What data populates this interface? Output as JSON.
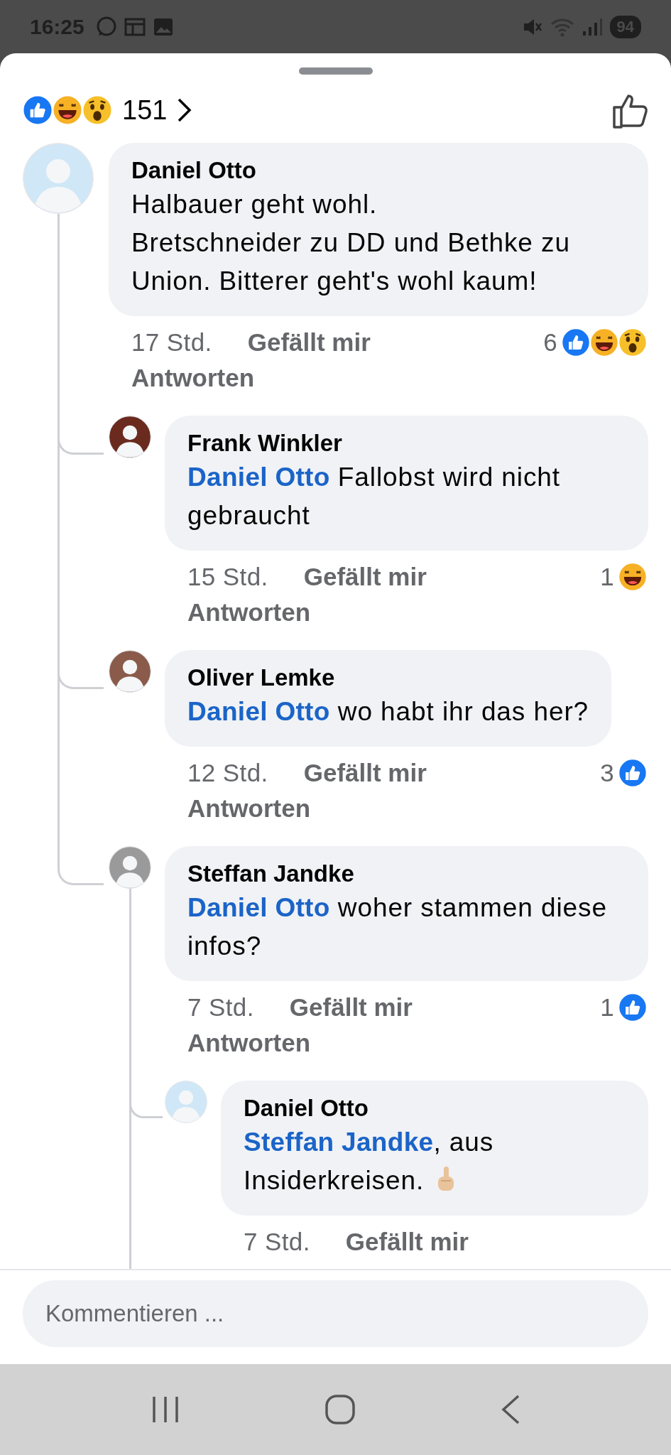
{
  "status_bar": {
    "time": "16:25",
    "battery": "94"
  },
  "header": {
    "reactions": [
      {
        "kind": "like"
      },
      {
        "kind": "haha"
      },
      {
        "kind": "wow"
      }
    ],
    "count": "151"
  },
  "comments": [
    {
      "author": "Daniel Otto",
      "text": "Halbauer geht wohl.\nBretschneider zu DD und Bethke zu Union. Bitterer geht's wohl kaum!",
      "time": "17 Std.",
      "like_label": "Gefällt mir",
      "reply_label": "Antworten",
      "reaction_count": "6",
      "reactions": [
        {
          "kind": "like"
        },
        {
          "kind": "haha"
        },
        {
          "kind": "wow"
        }
      ],
      "children": [
        {
          "author": "Frank Winkler",
          "mention": "Daniel Otto",
          "text": " Fallobst wird nicht gebraucht",
          "time": "15 Std.",
          "like_label": "Gefällt mir",
          "reply_label": "Antworten",
          "reaction_count": "1",
          "reactions": [
            {
              "kind": "haha"
            }
          ]
        },
        {
          "author": "Oliver Lemke",
          "mention": "Daniel Otto",
          "text": " wo habt ihr das her?",
          "time": "12 Std.",
          "like_label": "Gefällt mir",
          "reply_label": "Antworten",
          "reaction_count": "3",
          "reactions": [
            {
              "kind": "like"
            }
          ]
        },
        {
          "author": "Steffan Jandke",
          "mention": "Daniel Otto",
          "text": " woher stammen diese infos?",
          "time": "7 Std.",
          "like_label": "Gefällt mir",
          "reply_label": "Antworten",
          "reaction_count": "1",
          "reactions": [
            {
              "kind": "like"
            }
          ],
          "children": [
            {
              "author": "Daniel Otto",
              "mention": "Steffan Jandke",
              "text": ", aus Insiderkreisen.",
              "emoji": {
                "kind": "pointing-up"
              },
              "time": "7 Std.",
              "like_label": "Gefällt mir"
            }
          ]
        }
      ]
    }
  ],
  "composer": {
    "placeholder": "Kommentieren ..."
  }
}
